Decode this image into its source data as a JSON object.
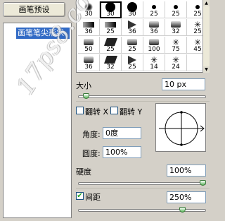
{
  "left_panel": {
    "preset_button": "画笔预设",
    "selected_item": "画笔笔尖形状"
  },
  "brush_grid": {
    "rows": [
      [
        {
          "size": "30",
          "shape": "soft"
        },
        {
          "size": "30",
          "shape": "big"
        },
        {
          "size": "30",
          "shape": "big-hard"
        },
        {
          "size": "25",
          "shape": "hard"
        },
        {
          "size": "25",
          "shape": "hard"
        },
        {
          "size": "25",
          "shape": "hard"
        }
      ],
      [
        {
          "size": "36",
          "shape": "rect"
        },
        {
          "size": "25",
          "shape": "rect"
        },
        {
          "size": "36",
          "shape": "cone"
        },
        {
          "size": "36",
          "shape": "cyl"
        },
        {
          "size": "32",
          "shape": "cyl"
        },
        {
          "size": "25",
          "shape": "splat"
        }
      ],
      [
        {
          "size": "50",
          "shape": "cyl"
        },
        {
          "size": "25",
          "shape": "par"
        },
        {
          "size": "25",
          "shape": "cyl"
        },
        {
          "size": "100",
          "shape": "cyl"
        },
        {
          "size": "75",
          "shape": "splat"
        },
        {
          "size": "45",
          "shape": "splat"
        }
      ],
      [
        {
          "size": "36",
          "shape": "cyl"
        },
        {
          "size": "32",
          "shape": "par"
        },
        {
          "size": "25",
          "shape": "cone"
        },
        {
          "size": "14",
          "shape": "splat"
        },
        {
          "size": "24",
          "shape": "splat"
        },
        {
          "size": "",
          "shape": "none"
        }
      ]
    ],
    "selected_index": 1
  },
  "controls": {
    "size_label": "大小",
    "size_value": "10 px",
    "size_slider": 0.04,
    "flip_x_label": "翻转 X",
    "flip_y_label": "翻转 Y",
    "flip_x_checked": false,
    "flip_y_checked": false,
    "angle_label": "角度:",
    "angle_value": "0度",
    "roundness_label": "圆度:",
    "roundness_value": "100%",
    "hardness_label": "硬度",
    "hardness_value": "100%",
    "hardness_slider": 1.0,
    "spacing_label": "间距",
    "spacing_checked": true,
    "spacing_value": "250%",
    "spacing_slider": 0.83
  },
  "watermark_text": "17ps8.com",
  "colors": {
    "selection": "#316ac5",
    "panel": "#d4d0c8",
    "slider_thumb": "#5cb85c"
  }
}
